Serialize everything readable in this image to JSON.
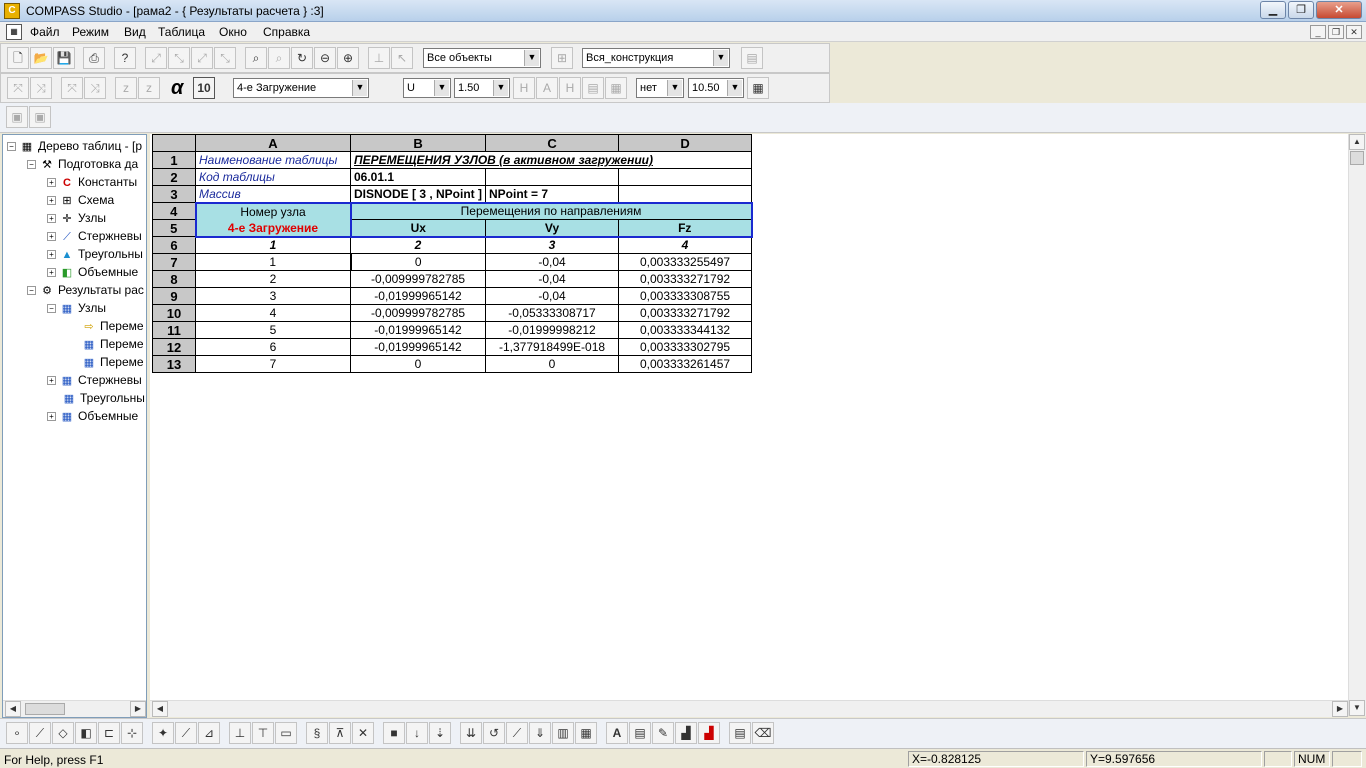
{
  "window": {
    "title": "COMPASS  Studio - [рама2 - { Результаты расчета } :3]",
    "app_icon": "app-icon"
  },
  "menu": [
    "Файл",
    "Режим",
    "Вид",
    "Таблица",
    "Окно",
    "Справка"
  ],
  "toolbar1": {
    "objects_combo": "Все объекты",
    "construct_combo": "Вся_конструкция"
  },
  "toolbar2": {
    "alpha_label": "α",
    "alpha_value": "10",
    "loading_combo": "4-е Загружение",
    "unit_combo": "U",
    "width_combo": "1.50",
    "flag_combo": "нет",
    "font_combo": "10.50"
  },
  "tree": [
    {
      "label": "Дерево таблиц - [р",
      "exp": "−",
      "icon": "table-tree-icon",
      "level": 0
    },
    {
      "label": "Подготовка да",
      "exp": "−",
      "icon": "tools-icon",
      "level": 1
    },
    {
      "label": "Константы",
      "exp": "+",
      "icon": "constants-icon",
      "level": 2
    },
    {
      "label": "Схема",
      "exp": "+",
      "icon": "scheme-icon",
      "level": 2
    },
    {
      "label": "Узлы",
      "exp": "+",
      "icon": "node-icon",
      "level": 2
    },
    {
      "label": "Стержневы",
      "exp": "+",
      "icon": "bar-icon",
      "level": 2
    },
    {
      "label": "Треугольны",
      "exp": "+",
      "icon": "triangle-icon",
      "level": 2
    },
    {
      "label": "Объемные",
      "exp": "+",
      "icon": "cube-icon",
      "level": 2
    },
    {
      "label": "Результаты рас",
      "exp": "−",
      "icon": "results-icon",
      "level": 1
    },
    {
      "label": "Узлы",
      "exp": "−",
      "icon": "table-icon",
      "level": 2
    },
    {
      "label": "Переме",
      "exp": "",
      "icon": "arrow-right-icon",
      "level": 3
    },
    {
      "label": "Переме",
      "exp": "",
      "icon": "table-icon",
      "level": 3
    },
    {
      "label": "Переме",
      "exp": "",
      "icon": "table-icon",
      "level": 3
    },
    {
      "label": "Стержневы",
      "exp": "+",
      "icon": "table-icon",
      "level": 2
    },
    {
      "label": "Треугольны",
      "exp": "",
      "icon": "table-icon",
      "level": 2
    },
    {
      "label": "Объемные",
      "exp": "+",
      "icon": "table-icon",
      "level": 2
    }
  ],
  "grid": {
    "columns": [
      "A",
      "B",
      "C",
      "D"
    ],
    "rows_numbers": [
      "1",
      "2",
      "3",
      "4",
      "5",
      "6",
      "7",
      "8",
      "9",
      "10",
      "11",
      "12",
      "13"
    ],
    "r1": {
      "a": "Наименование  таблицы",
      "b": "ПЕРЕМЕЩЕНИЯ УЗЛОВ (в активном загружении)"
    },
    "r2": {
      "a": "Код таблицы",
      "b": "06.01.1"
    },
    "r3": {
      "a": "Массив",
      "b": "DISNODE [ 3 , NPoint ]",
      "c": "NPoint = 7"
    },
    "r4": {
      "a": "Номер узла",
      "b": "Перемещения по направлениям"
    },
    "r5": {
      "a": "4-е Загружение",
      "b": "Ux",
      "c": "Vy",
      "d": "Fz"
    },
    "r6": {
      "a": "1",
      "b": "2",
      "c": "3",
      "d": "4"
    },
    "data": [
      [
        "1",
        "0",
        "-0,04",
        "0,003333255497"
      ],
      [
        "2",
        "-0,009999782785",
        "-0,04",
        "0,003333271792"
      ],
      [
        "3",
        "-0,01999965142",
        "-0,04",
        "0,003333308755"
      ],
      [
        "4",
        "-0,009999782785",
        "-0,05333308717",
        "0,003333271792"
      ],
      [
        "5",
        "-0,01999965142",
        "-0,01999998212",
        "0,003333344132"
      ],
      [
        "6",
        "-0,01999965142",
        "-1,377918499E-018",
        "0,003333302795"
      ],
      [
        "7",
        "0",
        "0",
        "0,003333261457"
      ]
    ]
  },
  "status": {
    "help": "For Help, press F1",
    "x": "X=-0.828125",
    "y": "Y=9.597656",
    "num": "NUM"
  }
}
